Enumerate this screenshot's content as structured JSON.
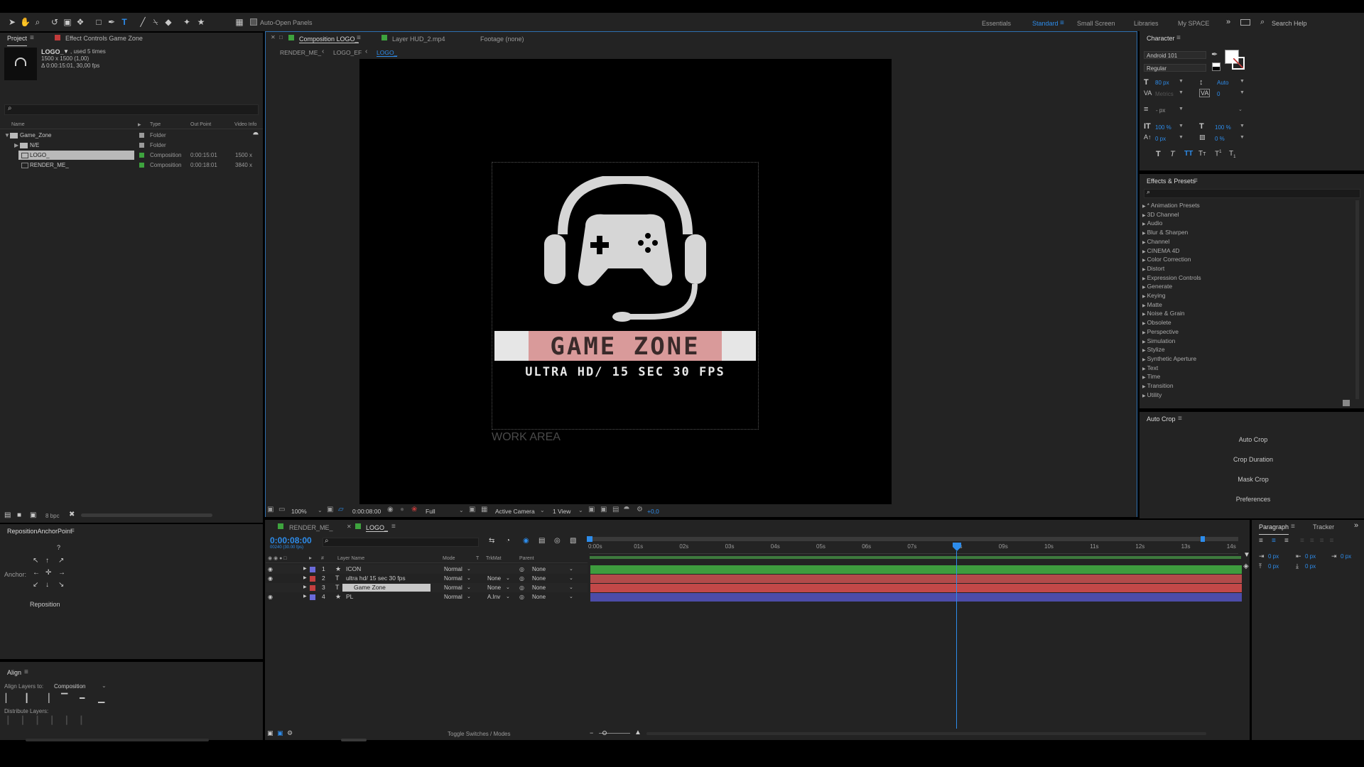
{
  "toolbar": {
    "auto_open": "Auto-Open Panels",
    "workspaces": [
      "Essentials",
      "Standard",
      "Small Screen",
      "Libraries",
      "My SPACE"
    ],
    "active_workspace": "Standard",
    "search_help": "Search Help"
  },
  "project": {
    "tab_project": "Project",
    "tab_effect": "Effect Controls Game Zone",
    "item_name": "LOGO_",
    "used": ", used 5 times",
    "dims": "1500 x 1500 (1,00)",
    "duration": "Δ 0:00:15:01, 30,00 fps",
    "col_name": "Name",
    "col_type": "Type",
    "col_out": "Out Point",
    "col_video": "Video Info",
    "rows": [
      {
        "name": "Game_Zone",
        "type": "Folder",
        "out": "",
        "video": "",
        "color": "#9a9a9a"
      },
      {
        "name": "N/E",
        "type": "Folder",
        "out": "",
        "video": "",
        "color": "#9a9a9a"
      },
      {
        "name": "LOGO_",
        "type": "Composition",
        "out": "0:00:15:01",
        "video": "1500 x",
        "color": "#3ea33e"
      },
      {
        "name": "RENDER_ME_",
        "type": "Composition",
        "out": "0:00:18:01",
        "video": "3840 x",
        "color": "#3ea33e"
      }
    ],
    "bpc": "8 bpc"
  },
  "comp_viewer": {
    "tabs": [
      "Composition LOGO_",
      "Layer HUD_2.mp4",
      "Footage (none)"
    ],
    "breadcrumbs": [
      "RENDER_ME_",
      "LOGO_EF",
      "LOGO_"
    ],
    "logo_title": "GAME ZONE",
    "logo_subtitle": "ULTRA HD/ 15 SEC 30 FPS",
    "work_area": "WORK AREA",
    "zoom": "100%",
    "timecode": "0:00:08:00",
    "resolution": "Full",
    "camera": "Active Camera",
    "view": "1 View",
    "exposure": "+0,0"
  },
  "character": {
    "title": "Character",
    "font": "Android 101",
    "style": "Regular",
    "size": "80 px",
    "leading": "Auto",
    "kerning": "Metrics",
    "tracking": "0",
    "stroke": "- px",
    "vscale": "100 %",
    "hscale": "100 %",
    "baseline": "0 px",
    "tsume": "0 %"
  },
  "effects": {
    "title": "Effects & Presets",
    "items": [
      "* Animation Presets",
      "3D Channel",
      "Audio",
      "Blur & Sharpen",
      "Channel",
      "CINEMA 4D",
      "Color Correction",
      "Distort",
      "Expression Controls",
      "Generate",
      "Keying",
      "Matte",
      "Noise & Grain",
      "Obsolete",
      "Perspective",
      "Simulation",
      "Stylize",
      "Synthetic Aperture",
      "Text",
      "Time",
      "Transition",
      "Utility"
    ]
  },
  "autocrop": {
    "title": "Auto Crop",
    "buttons": [
      "Auto Crop",
      "Crop Duration",
      "Mask Crop",
      "Preferences"
    ]
  },
  "reposition": {
    "title": "RepositionAnchorPoint",
    "help": "?",
    "anchor_label": "Anchor:",
    "button": "Reposition"
  },
  "align": {
    "title": "Align",
    "align_to_label": "Align Layers to:",
    "align_to_value": "Composition",
    "distribute": "Distribute Layers:"
  },
  "timeline": {
    "tabs": [
      "RENDER_ME_",
      "LOGO_"
    ],
    "timecode": "0:00:08:00",
    "frames": "00240 (30.00 fps)",
    "col_layer": "Layer Name",
    "col_mode": "Mode",
    "col_t": "T",
    "col_trkmat": "TrkMat",
    "col_parent": "Parent",
    "layers": [
      {
        "num": "1",
        "name": "ICON",
        "mode": "Normal",
        "trk": "",
        "parent": "None",
        "color": "#6a6ad9",
        "bar": "#3e9c3e"
      },
      {
        "num": "2",
        "name": "ultra hd/ 15 sec 30 fps",
        "mode": "Normal",
        "trk": "None",
        "parent": "None",
        "color": "#c44040",
        "bar": "#b24a4a"
      },
      {
        "num": "3",
        "name": "Game Zone",
        "mode": "Normal",
        "trk": "None",
        "parent": "None",
        "color": "#c44040",
        "bar": "#c24848"
      },
      {
        "num": "4",
        "name": "PL",
        "mode": "Normal",
        "trk": "A.Inv",
        "parent": "None",
        "color": "#6a6ad9",
        "bar": "#4c4ca8"
      }
    ],
    "ruler": [
      "0:00s",
      "01s",
      "02s",
      "03s",
      "04s",
      "05s",
      "06s",
      "07s",
      "08s",
      "09s",
      "10s",
      "11s",
      "12s",
      "13s",
      "14s"
    ],
    "toggle": "Toggle Switches / Modes"
  },
  "paragraph": {
    "tab_paragraph": "Paragraph",
    "tab_tracker": "Tracker",
    "vals": [
      "0 px",
      "0 px",
      "0 px",
      "0 px",
      "0 px"
    ]
  }
}
